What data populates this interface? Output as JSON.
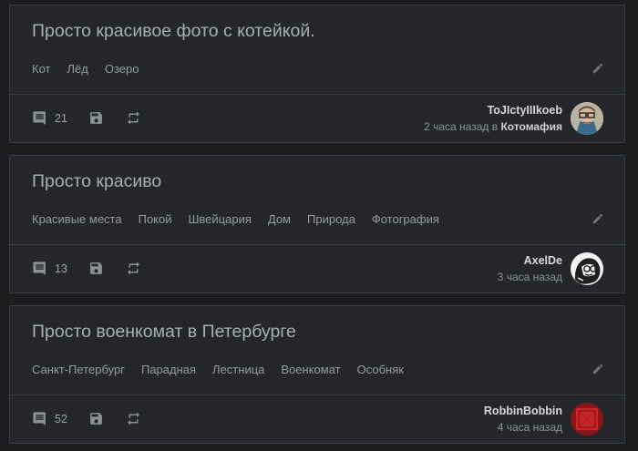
{
  "stories": [
    {
      "title": "Просто красивое фото с котейкой.",
      "tags": [
        "Кот",
        "Лёд",
        "Озеро"
      ],
      "comments": "21",
      "author": "ToJIctyIIIkoeb",
      "time": "2 часа назад",
      "in_word": "в",
      "community": "Котомафия",
      "avatar_icon": "avatar-glasses-man"
    },
    {
      "title": "Просто красиво",
      "tags": [
        "Красивые места",
        "Покой",
        "Швейцария",
        "Дом",
        "Природа",
        "Фотография"
      ],
      "comments": "13",
      "author": "AxelDe",
      "time": "3 часа назад",
      "in_word": "",
      "community": "",
      "avatar_icon": "avatar-cartoon-face"
    },
    {
      "title": "Просто военкомат в Петербурге",
      "tags": [
        "Санкт-Петербург",
        "Парадная",
        "Лестница",
        "Военкомат",
        "Особняк"
      ],
      "comments": "52",
      "author": "RobbinBobbin",
      "time": "4 часа назад",
      "in_word": "",
      "community": "",
      "avatar_icon": "avatar-red-square"
    }
  ],
  "colors": {
    "background": "#1a1c1e",
    "card": "#242629",
    "icon": "#8c9196",
    "accent_red": "#c8262b"
  }
}
